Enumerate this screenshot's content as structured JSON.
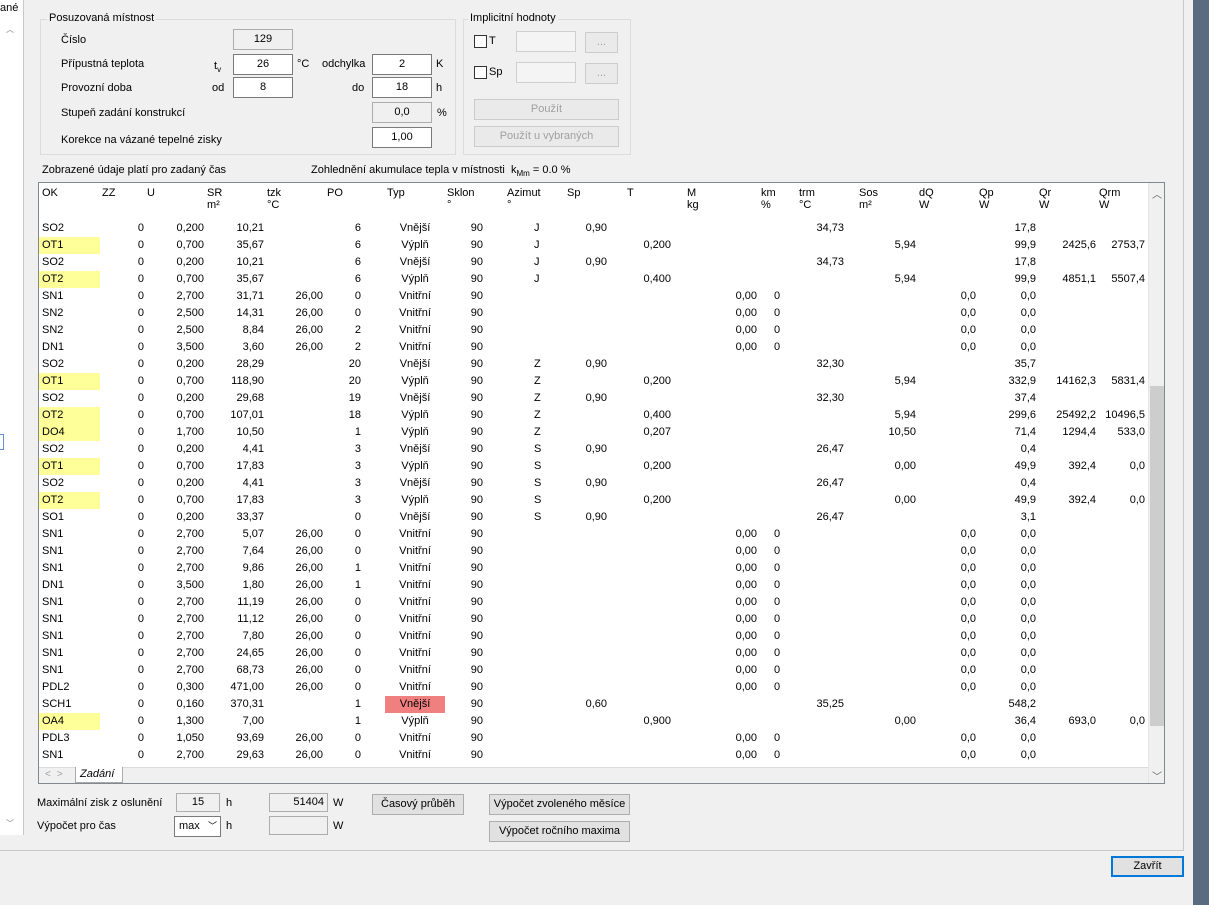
{
  "left_panel": {
    "cut_label": "ané"
  },
  "room": {
    "group_title": "Posuzovaná místnost",
    "number_label": "Číslo",
    "number_value": "129",
    "temp_label": "Přípustná teplota",
    "temp_symbol": "t",
    "temp_symbol_sub": "v",
    "temp_value": "26",
    "temp_unit": "°C",
    "deviation_label": "odchylka",
    "deviation_value": "2",
    "deviation_unit": "K",
    "hours_label": "Provozní doba",
    "from_label": "od",
    "from_value": "8",
    "to_label": "do",
    "to_value": "18",
    "to_unit": "h",
    "degree_label": "Stupeň zadání konstrukcí",
    "degree_value": "0,0",
    "degree_unit": "%",
    "correction_label": "Korekce na vázané tepelné zisky",
    "correction_value": "1,00"
  },
  "implicit": {
    "group_title": "Implicitní hodnoty",
    "t_label": "T",
    "sp_label": "Sp",
    "browse_label": "...",
    "apply_label": "Použít",
    "apply_selected_label": "Použít u vybraných"
  },
  "info": {
    "time_note": "Zobrazené údaje platí pro zadaný čas",
    "accum_note": "Zohlednění akumulace tepla v místnosti",
    "kmm_symbol": "k",
    "kmm_sub": "Mm",
    "kmm_value": "= 0.0 %"
  },
  "table": {
    "columns": [
      {
        "k": "ok",
        "t": "OK",
        "u": ""
      },
      {
        "k": "zz",
        "t": "ZZ",
        "u": ""
      },
      {
        "k": "u",
        "t": "U",
        "u": ""
      },
      {
        "k": "sr",
        "t": "SR",
        "u": "m²"
      },
      {
        "k": "tzk",
        "t": "tzk",
        "u": "°C"
      },
      {
        "k": "po",
        "t": "PO",
        "u": ""
      },
      {
        "k": "typ",
        "t": "Typ",
        "u": ""
      },
      {
        "k": "sklon",
        "t": "Sklon",
        "u": "°"
      },
      {
        "k": "azimut",
        "t": "Azimut",
        "u": "°"
      },
      {
        "k": "sp",
        "t": "Sp",
        "u": ""
      },
      {
        "k": "tt",
        "t": "T",
        "u": ""
      },
      {
        "k": "m",
        "t": "M",
        "u": "kg"
      },
      {
        "k": "km",
        "t": "km",
        "u": "%"
      },
      {
        "k": "trm",
        "t": "trm",
        "u": "°C"
      },
      {
        "k": "sos",
        "t": "Sos",
        "u": "m²"
      },
      {
        "k": "dq",
        "t": "dQ",
        "u": "W"
      },
      {
        "k": "qp",
        "t": "Qp",
        "u": "W"
      },
      {
        "k": "qr",
        "t": "Qr",
        "u": "W"
      },
      {
        "k": "qrm",
        "t": "Qrm",
        "u": "W"
      }
    ],
    "rows": [
      [
        "SO2",
        "0",
        "0,200",
        "10,21",
        "",
        "6",
        "Vnější",
        "90",
        "J",
        "0,90",
        "",
        "",
        "",
        "34,73",
        "",
        "",
        "17,8",
        "",
        ""
      ],
      [
        "OT1",
        "0",
        "0,700",
        "35,67",
        "",
        "6",
        "Výplň",
        "90",
        "J",
        "",
        "0,200",
        "",
        "",
        "",
        "5,94",
        "",
        "99,9",
        "2425,6",
        "2753,7"
      ],
      [
        "SO2",
        "0",
        "0,200",
        "10,21",
        "",
        "6",
        "Vnější",
        "90",
        "J",
        "0,90",
        "",
        "",
        "",
        "34,73",
        "",
        "",
        "17,8",
        "",
        ""
      ],
      [
        "OT2",
        "0",
        "0,700",
        "35,67",
        "",
        "6",
        "Výplň",
        "90",
        "J",
        "",
        "0,400",
        "",
        "",
        "",
        "5,94",
        "",
        "99,9",
        "4851,1",
        "5507,4"
      ],
      [
        "SN1",
        "0",
        "2,700",
        "31,71",
        "26,00",
        "0",
        "Vnitřní",
        "90",
        "",
        "",
        "",
        "0,00",
        "0",
        "",
        "",
        "0,0",
        "0,0",
        "",
        ""
      ],
      [
        "SN2",
        "0",
        "2,500",
        "14,31",
        "26,00",
        "0",
        "Vnitřní",
        "90",
        "",
        "",
        "",
        "0,00",
        "0",
        "",
        "",
        "0,0",
        "0,0",
        "",
        ""
      ],
      [
        "SN2",
        "0",
        "2,500",
        "8,84",
        "26,00",
        "2",
        "Vnitřní",
        "90",
        "",
        "",
        "",
        "0,00",
        "0",
        "",
        "",
        "0,0",
        "0,0",
        "",
        ""
      ],
      [
        "DN1",
        "0",
        "3,500",
        "3,60",
        "26,00",
        "2",
        "Vnitřní",
        "90",
        "",
        "",
        "",
        "0,00",
        "0",
        "",
        "",
        "0,0",
        "0,0",
        "",
        ""
      ],
      [
        "SO2",
        "0",
        "0,200",
        "28,29",
        "",
        "20",
        "Vnější",
        "90",
        "Z",
        "0,90",
        "",
        "",
        "",
        "32,30",
        "",
        "",
        "35,7",
        "",
        ""
      ],
      [
        "OT1",
        "0",
        "0,700",
        "118,90",
        "",
        "20",
        "Výplň",
        "90",
        "Z",
        "",
        "0,200",
        "",
        "",
        "",
        "5,94",
        "",
        "332,9",
        "14162,3",
        "5831,4"
      ],
      [
        "SO2",
        "0",
        "0,200",
        "29,68",
        "",
        "19",
        "Vnější",
        "90",
        "Z",
        "0,90",
        "",
        "",
        "",
        "32,30",
        "",
        "",
        "37,4",
        "",
        ""
      ],
      [
        "OT2",
        "0",
        "0,700",
        "107,01",
        "",
        "18",
        "Výplň",
        "90",
        "Z",
        "",
        "0,400",
        "",
        "",
        "",
        "5,94",
        "",
        "299,6",
        "25492,2",
        "10496,5"
      ],
      [
        "DO4",
        "0",
        "1,700",
        "10,50",
        "",
        "1",
        "Výplň",
        "90",
        "Z",
        "",
        "0,207",
        "",
        "",
        "",
        "10,50",
        "",
        "71,4",
        "1294,4",
        "533,0"
      ],
      [
        "SO2",
        "0",
        "0,200",
        "4,41",
        "",
        "3",
        "Vnější",
        "90",
        "S",
        "0,90",
        "",
        "",
        "",
        "26,47",
        "",
        "",
        "0,4",
        "",
        ""
      ],
      [
        "OT1",
        "0",
        "0,700",
        "17,83",
        "",
        "3",
        "Výplň",
        "90",
        "S",
        "",
        "0,200",
        "",
        "",
        "",
        "0,00",
        "",
        "49,9",
        "392,4",
        "0,0"
      ],
      [
        "SO2",
        "0",
        "0,200",
        "4,41",
        "",
        "3",
        "Vnější",
        "90",
        "S",
        "0,90",
        "",
        "",
        "",
        "26,47",
        "",
        "",
        "0,4",
        "",
        ""
      ],
      [
        "OT2",
        "0",
        "0,700",
        "17,83",
        "",
        "3",
        "Výplň",
        "90",
        "S",
        "",
        "0,200",
        "",
        "",
        "",
        "0,00",
        "",
        "49,9",
        "392,4",
        "0,0"
      ],
      [
        "SO1",
        "0",
        "0,200",
        "33,37",
        "",
        "0",
        "Vnější",
        "90",
        "S",
        "0,90",
        "",
        "",
        "",
        "26,47",
        "",
        "",
        "3,1",
        "",
        ""
      ],
      [
        "SN1",
        "0",
        "2,700",
        "5,07",
        "26,00",
        "0",
        "Vnitřní",
        "90",
        "",
        "",
        "",
        "0,00",
        "0",
        "",
        "",
        "0,0",
        "0,0",
        "",
        ""
      ],
      [
        "SN1",
        "0",
        "2,700",
        "7,64",
        "26,00",
        "0",
        "Vnitřní",
        "90",
        "",
        "",
        "",
        "0,00",
        "0",
        "",
        "",
        "0,0",
        "0,0",
        "",
        ""
      ],
      [
        "SN1",
        "0",
        "2,700",
        "9,86",
        "26,00",
        "1",
        "Vnitřní",
        "90",
        "",
        "",
        "",
        "0,00",
        "0",
        "",
        "",
        "0,0",
        "0,0",
        "",
        ""
      ],
      [
        "DN1",
        "0",
        "3,500",
        "1,80",
        "26,00",
        "1",
        "Vnitřní",
        "90",
        "",
        "",
        "",
        "0,00",
        "0",
        "",
        "",
        "0,0",
        "0,0",
        "",
        ""
      ],
      [
        "SN1",
        "0",
        "2,700",
        "11,19",
        "26,00",
        "0",
        "Vnitřní",
        "90",
        "",
        "",
        "",
        "0,00",
        "0",
        "",
        "",
        "0,0",
        "0,0",
        "",
        ""
      ],
      [
        "SN1",
        "0",
        "2,700",
        "11,12",
        "26,00",
        "0",
        "Vnitřní",
        "90",
        "",
        "",
        "",
        "0,00",
        "0",
        "",
        "",
        "0,0",
        "0,0",
        "",
        ""
      ],
      [
        "SN1",
        "0",
        "2,700",
        "7,80",
        "26,00",
        "0",
        "Vnitřní",
        "90",
        "",
        "",
        "",
        "0,00",
        "0",
        "",
        "",
        "0,0",
        "0,0",
        "",
        ""
      ],
      [
        "SN1",
        "0",
        "2,700",
        "24,65",
        "26,00",
        "0",
        "Vnitřní",
        "90",
        "",
        "",
        "",
        "0,00",
        "0",
        "",
        "",
        "0,0",
        "0,0",
        "",
        ""
      ],
      [
        "SN1",
        "0",
        "2,700",
        "68,73",
        "26,00",
        "0",
        "Vnitřní",
        "90",
        "",
        "",
        "",
        "0,00",
        "0",
        "",
        "",
        "0,0",
        "0,0",
        "",
        ""
      ],
      [
        "PDL2",
        "0",
        "0,300",
        "471,00",
        "26,00",
        "0",
        "Vnitřní",
        "90",
        "",
        "",
        "",
        "0,00",
        "0",
        "",
        "",
        "0,0",
        "0,0",
        "",
        ""
      ],
      [
        "SCH1",
        "0",
        "0,160",
        "370,31",
        "",
        "1",
        "Vnější",
        "90",
        "",
        "0,60",
        "",
        "",
        "",
        "35,25",
        "",
        "",
        "548,2",
        "",
        ""
      ],
      [
        "OA4",
        "0",
        "1,300",
        "7,00",
        "",
        "1",
        "Výplň",
        "90",
        "",
        "",
        "0,900",
        "",
        "",
        "",
        "0,00",
        "",
        "36,4",
        "693,0",
        "0,0"
      ],
      [
        "PDL3",
        "0",
        "1,050",
        "93,69",
        "26,00",
        "0",
        "Vnitřní",
        "90",
        "",
        "",
        "",
        "0,00",
        "0",
        "",
        "",
        "0,0",
        "0,0",
        "",
        ""
      ],
      [
        "SN1",
        "0",
        "2,700",
        "29,63",
        "26,00",
        "0",
        "Vnitřní",
        "90",
        "",
        "",
        "",
        "0,00",
        "0",
        "",
        "",
        "0,0",
        "0,0",
        "",
        ""
      ]
    ],
    "highlight_color": "#ffff99",
    "alert_color": "#f08080",
    "alert_row_index": 28,
    "tab_label": "Zadání"
  },
  "bottom": {
    "max_gain_label": "Maximální zisk z oslunění",
    "max_gain_hour": "15",
    "hour_unit": "h",
    "max_gain_value": "51404",
    "watt_unit": "W",
    "time_calc_label": "Výpočet pro čas",
    "time_calc_value": "max",
    "time_profile_label": "Časový průběh",
    "month_calc_label": "Výpočet zvoleného měsíce",
    "annual_max_label": "Výpočet ročního maxima",
    "close_label": "Zavřít"
  }
}
